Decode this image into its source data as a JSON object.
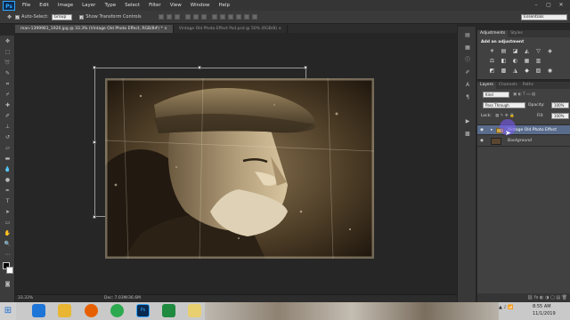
{
  "app": {
    "logo": "Ps",
    "brand_color": "#31a8ff"
  },
  "menu": [
    "File",
    "Edit",
    "Image",
    "Layer",
    "Type",
    "Select",
    "Filter",
    "View",
    "Window",
    "Help"
  ],
  "window_controls": [
    "–",
    "▢",
    "✕"
  ],
  "options": {
    "auto_select_label": "Auto-Select:",
    "auto_select_value": "Group",
    "show_transform_label": "Show Transform Controls",
    "workspace": "Essentials"
  },
  "tabs": [
    {
      "label": "man-1399961_1920.jpg @ 33.3% (Vintage Old Photo Effect, RGB/8#) *  ×",
      "active": true
    },
    {
      "label": "Vintage Old Photo Effect Psd.psd @ 50% (RGB/8)  ×",
      "active": false
    }
  ],
  "status": {
    "zoom": "33.33%",
    "doc": "Doc: 7.03M/36.6M"
  },
  "adjustments": {
    "tabs": [
      "Adjustments",
      "Styles"
    ],
    "title": "Add an adjustment",
    "icons": [
      "☀",
      "▤",
      "◪",
      "◭",
      "▽",
      "◈",
      "⚖",
      "◧",
      "◐",
      "▦",
      "▥",
      "◫",
      "◩",
      "▩",
      "◮",
      "◆",
      "▧",
      "◉"
    ]
  },
  "layers": {
    "tabs": [
      "Layers",
      "Channels",
      "Paths"
    ],
    "filter": "Kind",
    "blend_mode": "Pass Through",
    "opacity_label": "Opacity:",
    "opacity_value": "100%",
    "lock_label": "Lock:",
    "fill_label": "Fill:",
    "fill_value": "100%",
    "items": [
      {
        "name": "Vintage Old Photo Effect",
        "selected": true
      },
      {
        "name": "Background",
        "selected": false
      }
    ]
  },
  "taskbar": {
    "time": "8:55 AM",
    "date": "11/1/2019"
  }
}
